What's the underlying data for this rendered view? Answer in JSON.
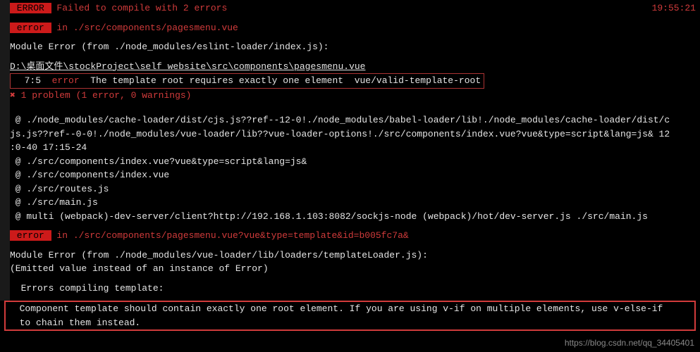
{
  "header": {
    "error_badge": " ERROR ",
    "fail_msg": " Failed to compile with 2 errors",
    "timestamp": "19:55:21"
  },
  "block1": {
    "error_badge": " error ",
    "in_text": " in ./src/components/pagesmenu.vue",
    "module_error": "Module Error (from ./node_modules/eslint-loader/index.js):",
    "filepath": "D:\\桌面文件\\stockProject\\self website\\src\\components\\pagesmenu.vue",
    "lint_loc": "  7:5  ",
    "lint_level": "error",
    "lint_msg": "  The template root requires exactly one element  vue/valid-template-root",
    "problem_summary": "✖ 1 problem (1 error, 0 warnings)"
  },
  "stack": {
    "l1": " @ ./node_modules/cache-loader/dist/cjs.js??ref--12-0!./node_modules/babel-loader/lib!./node_modules/cache-loader/dist/c",
    "l2": "js.js??ref--0-0!./node_modules/vue-loader/lib??vue-loader-options!./src/components/index.vue?vue&type=script&lang=js& 12",
    "l3": ":0-40 17:15-24",
    "l4": " @ ./src/components/index.vue?vue&type=script&lang=js&",
    "l5": " @ ./src/components/index.vue",
    "l6": " @ ./src/routes.js",
    "l7": " @ ./src/main.js",
    "l8": " @ multi (webpack)-dev-server/client?http://192.168.1.103:8082/sockjs-node (webpack)/hot/dev-server.js ./src/main.js"
  },
  "block2": {
    "error_badge": " error ",
    "in_text": " in ./src/components/pagesmenu.vue?vue&type=template&id=b005fc7a&",
    "module_error": "Module Error (from ./node_modules/vue-loader/lib/loaders/templateLoader.js):",
    "emitted": "(Emitted value instead of an instance of Error)",
    "errors_compiling": "  Errors compiling template:",
    "component_msg": "  Component template should contain exactly one root element. If you are using v-if on multiple elements, use v-else-if\n  to chain them instead."
  },
  "watermark": "https://blog.csdn.net/qq_34405401"
}
